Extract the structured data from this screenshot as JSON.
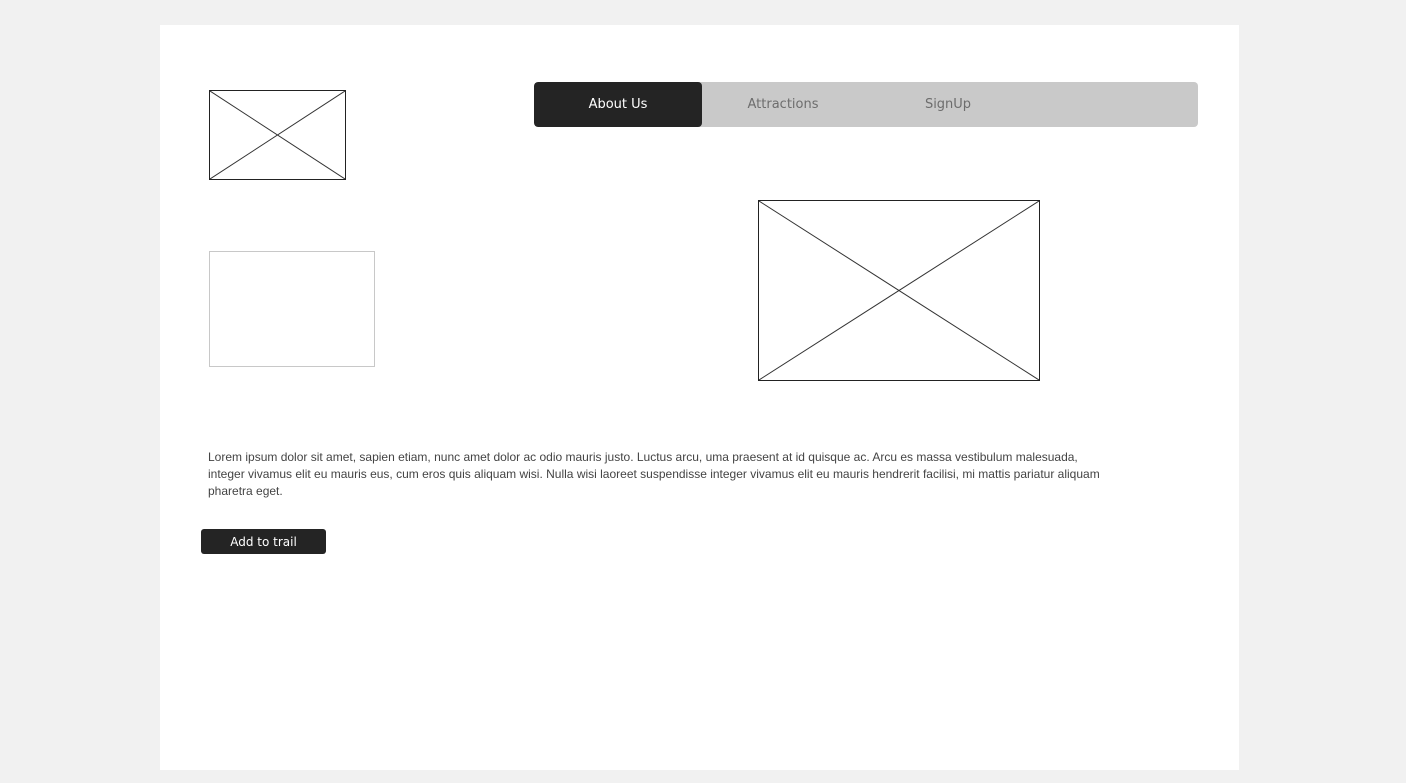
{
  "nav": {
    "items": [
      {
        "label": "About Us",
        "active": true
      },
      {
        "label": "Attractions",
        "active": false
      },
      {
        "label": "SignUp",
        "active": false
      }
    ]
  },
  "content": {
    "paragraph": "Lorem ipsum dolor sit amet, sapien etiam, nunc amet dolor ac odio mauris justo. Luctus arcu, uma praesent at id quisque ac. Arcu es massa vestibulum malesuada, integer vivamus elit eu mauris eus, cum eros quis aliquam wisi. Nulla wisi laoreet suspendisse integer vivamus elit eu mauris hendrerit facilisi, mi mattis pariatur aliquam pharetra eget.",
    "button_label": "Add to trail"
  },
  "colors": {
    "page_background": "#f1f1f1",
    "canvas": "#ffffff",
    "nav_bar": "#c9c9c9",
    "nav_active": "#242424",
    "button": "#242424"
  },
  "icons": {
    "logo": "image-placeholder-icon",
    "hero": "image-placeholder-icon"
  }
}
